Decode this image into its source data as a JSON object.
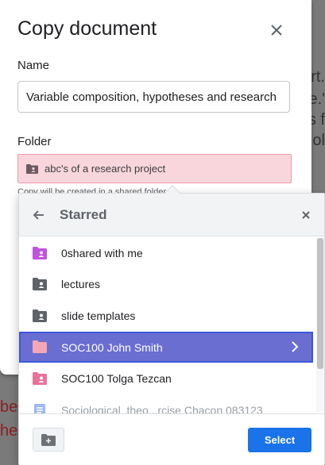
{
  "dialog": {
    "title": "Copy document",
    "name_label": "Name",
    "name_value": "Variable composition, hypotheses and research",
    "folder_label": "Folder",
    "folder_value": "abc's of a research project",
    "hint": "Copy will be created in a shared folder"
  },
  "background": {
    "right_lines": [
      "rt.",
      "e.'",
      "s f",
      "ol"
    ],
    "left_lines": [
      "bes",
      "he"
    ]
  },
  "picker": {
    "title": "Starred",
    "items": [
      {
        "label": "0shared with me",
        "icon": "shared-folder-icon",
        "color": "#c153e0"
      },
      {
        "label": "lectures",
        "icon": "shared-folder-icon",
        "color": "#5f6368"
      },
      {
        "label": "slide templates",
        "icon": "shared-folder-icon",
        "color": "#5f6368"
      },
      {
        "label": "SOC100 John Smith",
        "icon": "folder-icon",
        "color": "#f3a6b6"
      },
      {
        "label": "SOC100 Tolga Tezcan",
        "icon": "shared-folder-icon",
        "color": "#e8739a"
      },
      {
        "label": "Sociological_theo...rcise Chacon 083123",
        "icon": "doc-icon",
        "color": "#7ba0f0"
      }
    ],
    "select_label": "Select"
  },
  "colors": {
    "selected_row": "#6a6ed1",
    "select_button": "#1a73e8",
    "folder_select_bg": "#f8d6dc"
  }
}
